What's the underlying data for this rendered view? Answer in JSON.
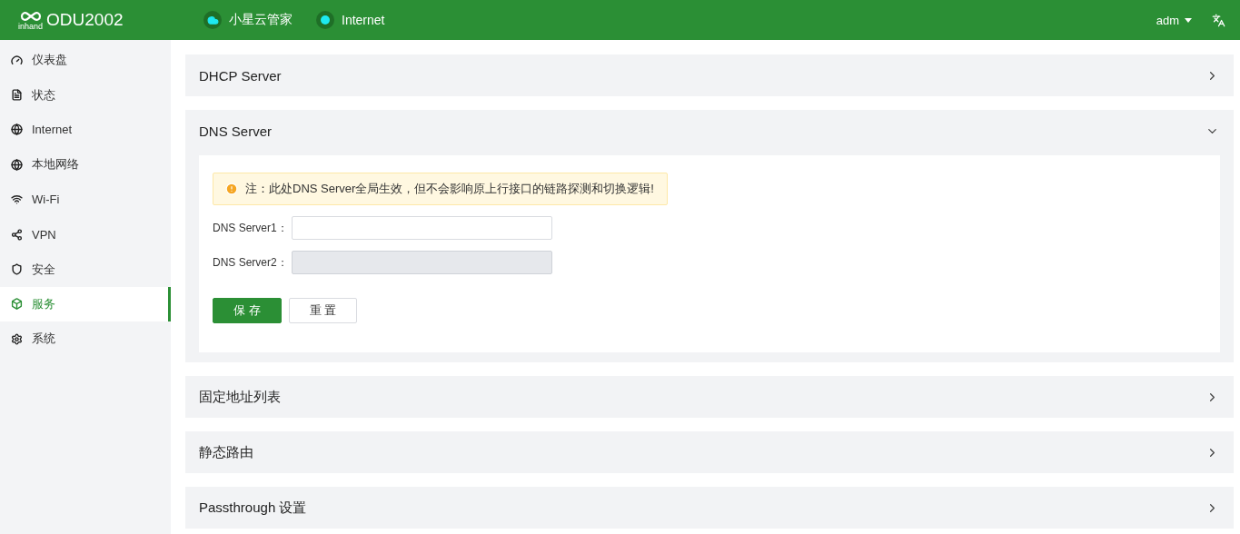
{
  "header": {
    "logo_text": "inhand",
    "product": "ODU2002",
    "status_items": [
      {
        "kind": "cloud",
        "label": "小星云管家"
      },
      {
        "kind": "dot",
        "label": "Internet"
      }
    ],
    "user": "adm"
  },
  "sidebar": {
    "items": [
      {
        "label": "仪表盘",
        "selected": false
      },
      {
        "label": "状态",
        "selected": false
      },
      {
        "label": "Internet",
        "selected": false
      },
      {
        "label": "本地网络",
        "selected": false
      },
      {
        "label": "Wi-Fi",
        "selected": false
      },
      {
        "label": "VPN",
        "selected": false
      },
      {
        "label": "安全",
        "selected": false
      },
      {
        "label": "服务",
        "selected": true
      },
      {
        "label": "系统",
        "selected": false
      }
    ]
  },
  "panels": [
    {
      "title": "DHCP Server",
      "expanded": false
    },
    {
      "title": "DNS Server",
      "expanded": true,
      "notice": "注：此处DNS Server全局生效，但不会影响原上行接口的链路探测和切换逻辑!",
      "fields": [
        {
          "label": "DNS Server1：",
          "disabled": false
        },
        {
          "label": "DNS Server2：",
          "disabled": true
        }
      ],
      "buttons": [
        {
          "label": "保 存",
          "kind": "primary"
        },
        {
          "label": "重 置",
          "kind": "default"
        }
      ]
    },
    {
      "title": "固定地址列表",
      "expanded": false
    },
    {
      "title": "静态路由",
      "expanded": false
    },
    {
      "title": "Passthrough 设置",
      "expanded": false
    }
  ]
}
